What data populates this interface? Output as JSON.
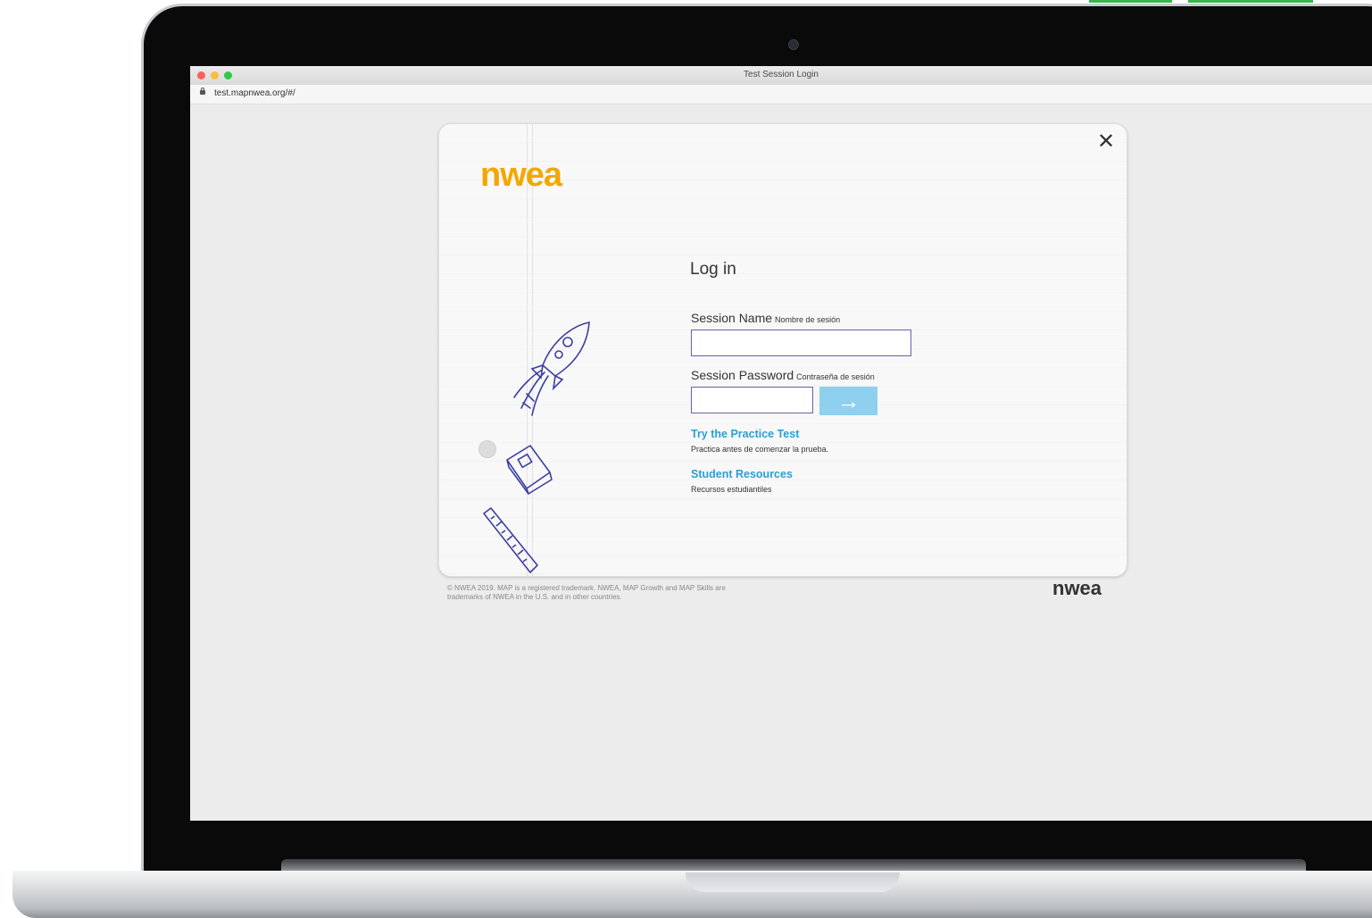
{
  "browser": {
    "window_title": "Test Session Login",
    "url": "test.mapnwea.org/#/"
  },
  "login": {
    "logo": "nwea",
    "heading": "Log in",
    "session_name_label": "Session Name",
    "session_name_sublabel": "Nombre de sesión",
    "session_name_value": "",
    "session_password_label": "Session Password",
    "session_password_sublabel": "Contraseña de sesión",
    "session_password_value": "",
    "submit_arrow": "→",
    "close_symbol": "✕",
    "practice_link": "Try the Practice Test",
    "practice_sub": "Practica antes de comenzar la prueba.",
    "resources_link": "Student Resources",
    "resources_sub": "Recursos estudiantiles"
  },
  "footer": {
    "copyright": "© NWEA 2019. MAP is a registered trademark. NWEA, MAP Growth and MAP Skills are trademarks of NWEA in the U.S. and in other countries.",
    "logo": "nwea"
  },
  "colors": {
    "brand_orange": "#f3a700",
    "link_blue": "#2a9fd6",
    "submit_button": "#8fd0ef",
    "traffic_red": "#fc605c",
    "traffic_yellow": "#fdbc40",
    "traffic_green": "#34c84a"
  }
}
